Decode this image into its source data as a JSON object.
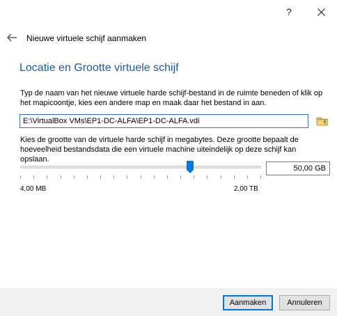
{
  "window": {
    "help_label": "?",
    "close_icon": "close-icon"
  },
  "header": {
    "back_icon": "back-arrow-icon",
    "title": "Nieuwe virtuele schijf aanmaken"
  },
  "page": {
    "heading": "Locatie en Grootte virtuele schijf",
    "location_description": "Typ de naam van het nieuwe virtuele harde schijf-bestand in de ruimte beneden of klik op het mapicoontje, kies een andere map en maak daar het bestand in aan.",
    "file_path": "E:\\VirtualBox VMs\\EP1-DC-ALFA\\EP1-DC-ALFA.vdi",
    "folder_icon": "folder-icon",
    "size_description": "Kies de grootte van de virtuele harde schijf in megabytes. Deze grootte bepaalt de hoeveelheid bestandsdata die een virtuele machine uiteindelijk op deze schijf kan opslaan.",
    "size_value": "50,00 GB",
    "slider_position": 0.705,
    "min_label": "4,00 MB",
    "max_label": "2,00 TB"
  },
  "footer": {
    "create_label": "Aanmaken",
    "cancel_label": "Annuleren"
  },
  "colors": {
    "heading": "#1c5aa5",
    "accent": "#0078d7",
    "footer_bg": "#f0f0f0"
  }
}
